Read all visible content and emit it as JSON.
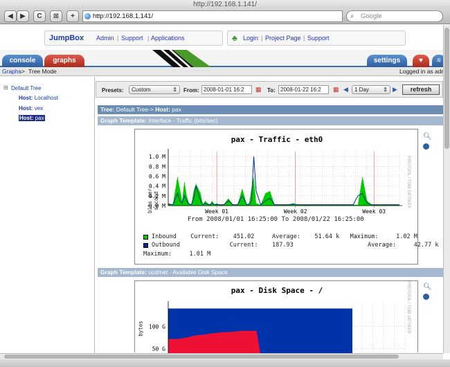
{
  "window": {
    "title": "http://192.168.1.141/"
  },
  "browser": {
    "url": "http://192.168.1.141/",
    "search_placeholder": "Google",
    "back_icon": "◀",
    "forward_icon": "▶",
    "reload_icon": "C",
    "add_icon": "+"
  },
  "header": {
    "logo": "JumpBox",
    "nav": [
      "Admin",
      "Support",
      "Applications"
    ],
    "right_nav": [
      "Login",
      "Project Page",
      "Support"
    ]
  },
  "tabs": {
    "console": "console",
    "graphs": "graphs",
    "settings": "settings"
  },
  "breadcrumb": {
    "root": "Graphs",
    "sep": "->",
    "current": "Tree Mode"
  },
  "login_status": "Logged in as adm",
  "tree": {
    "root": "Default Tree",
    "hosts": [
      {
        "prefix": "Host:",
        "name": "Localhost"
      },
      {
        "prefix": "Host:",
        "name": "vex"
      },
      {
        "prefix": "Host:",
        "name": "pax"
      }
    ]
  },
  "filter": {
    "presets_label": "Presets:",
    "preset_value": "Custom",
    "from_label": "From:",
    "from_value": "2008-01-01 16:2",
    "to_label": "To:",
    "to_value": "2008-01-22 16:2",
    "span_value": "1 Day",
    "refresh_label": "refresh"
  },
  "tree_header": {
    "tree_label": "Tree:",
    "tree_value": "Default Tree->",
    "host_label": "Host:",
    "host_value": "pax"
  },
  "graphs": [
    {
      "template_label": "Graph Template:",
      "template_value": "Interface - Traffic (bits/sec)",
      "title": "pax - Traffic - eth0",
      "ylabel": "bits per second",
      "yticks": [
        "1.0 M",
        "0.8 M",
        "0.6 M",
        "0.4 M",
        "0.2 M",
        "0.0 M"
      ],
      "xticks": [
        "Week 01",
        "Week 02",
        "Week 03"
      ],
      "range_text": "From 2008/01/01 16:25:00 To 2008/01/22 16:25:00",
      "side_text": "RRDTOOL / TOBI OETIKER",
      "legend_line1": "Inbound    Current:    451.02     Average:    51.64 k   Maximum:     1.02 M",
      "legend_line2": "Outbound              Current:    187.93                     Average:     42.77 k",
      "legend_line3": "Maximum:     1.01 M"
    },
    {
      "template_label": "Graph Template:",
      "template_value": "ucd/net - Available Disk Space",
      "title": "pax - Disk Space - /",
      "ylabel": "bytes",
      "yticks": [
        "100 G",
        "50 G"
      ],
      "side_text": "RRDTOOL / TOBI OETIKER"
    }
  ],
  "colors": {
    "inbound": "#00cc00",
    "outbound": "#002a97",
    "disk_used": "#ee1133",
    "disk_free": "#0033aa",
    "tab_blue": "#3a6fb0",
    "tab_red": "#c0392b"
  },
  "chart_data": [
    {
      "type": "area",
      "title": "pax - Traffic - eth0",
      "ylabel": "bits per second",
      "xlabel": "",
      "x_ticks": [
        "Week 01",
        "Week 02",
        "Week 03"
      ],
      "ylim": [
        0,
        1.1
      ],
      "grid": true,
      "x": [
        0,
        2,
        4,
        5,
        6,
        7,
        8,
        9,
        10,
        11,
        12,
        14,
        15,
        16,
        17,
        18,
        19,
        20,
        21,
        22,
        24,
        26,
        28,
        30,
        32,
        34,
        35,
        36,
        37,
        38,
        40,
        42,
        44,
        46,
        48,
        50,
        52,
        54,
        56,
        58,
        60,
        62,
        64,
        66,
        68,
        70,
        72,
        74,
        76,
        78,
        80,
        82,
        84,
        86,
        88,
        90,
        92,
        94,
        96,
        98,
        100
      ],
      "series": [
        {
          "name": "Inbound",
          "values": [
            0.05,
            0.02,
            0.6,
            0.35,
            0.1,
            0.5,
            0.2,
            0.05,
            0.02,
            0.3,
            0.45,
            0.25,
            0.02,
            0.1,
            0.05,
            0.02,
            0.1,
            0.02,
            0.05,
            0.02,
            0.02,
            0.15,
            0.02,
            0.02,
            0.35,
            0.02,
            0.05,
            0.35,
            0.6,
            0.05,
            0.02,
            0.25,
            0.3,
            0.02,
            0.02,
            0.02,
            0.02,
            0.05,
            0.02,
            0.02,
            0.02,
            0.02,
            0.02,
            0.02,
            0.02,
            0.02,
            0.02,
            0.02,
            0.02,
            0.02,
            0.02,
            0.02,
            0.6,
            0.1,
            0.02,
            0.02,
            0.02,
            0.02,
            0.02,
            0.02,
            0.02
          ]
        },
        {
          "name": "Outbound",
          "values": [
            0.03,
            0.02,
            0.25,
            0.1,
            0.05,
            0.2,
            0.1,
            0.03,
            0.02,
            0.15,
            0.4,
            0.1,
            0.02,
            0.05,
            0.03,
            0.02,
            0.05,
            0.02,
            0.03,
            0.02,
            0.02,
            0.1,
            0.02,
            0.02,
            0.2,
            0.02,
            0.03,
            0.1,
            1.0,
            0.3,
            0.02,
            0.1,
            0.15,
            0.02,
            0.02,
            0.02,
            0.02,
            0.03,
            0.02,
            0.02,
            0.02,
            0.02,
            0.02,
            0.02,
            0.02,
            0.02,
            0.02,
            0.02,
            0.02,
            0.02,
            0.02,
            0.2,
            0.25,
            0.05,
            0.02,
            0.02,
            0.02,
            0.02,
            0.02,
            0.02,
            0.02
          ]
        }
      ]
    },
    {
      "type": "area",
      "title": "pax - Disk Space - /",
      "ylabel": "bytes",
      "xlabel": "",
      "ylim": [
        0,
        150
      ],
      "grid": true,
      "x": [
        0,
        5,
        10,
        15,
        20,
        25,
        30,
        35,
        40,
        45,
        48,
        50,
        52,
        55,
        60,
        65,
        70,
        75,
        80,
        85,
        90,
        95,
        100
      ],
      "series": [
        {
          "name": "Used",
          "values": [
            72,
            72,
            75,
            80,
            82,
            85,
            87,
            88,
            90,
            90,
            90,
            40,
            40,
            40,
            40,
            40,
            40,
            40,
            40,
            40,
            40,
            40,
            40
          ]
        },
        {
          "name": "Free",
          "values": [
            140,
            140,
            140,
            140,
            140,
            140,
            140,
            140,
            140,
            140,
            140,
            140,
            140,
            140,
            140,
            140,
            140,
            140,
            140,
            140,
            140,
            140,
            140
          ]
        }
      ]
    }
  ]
}
